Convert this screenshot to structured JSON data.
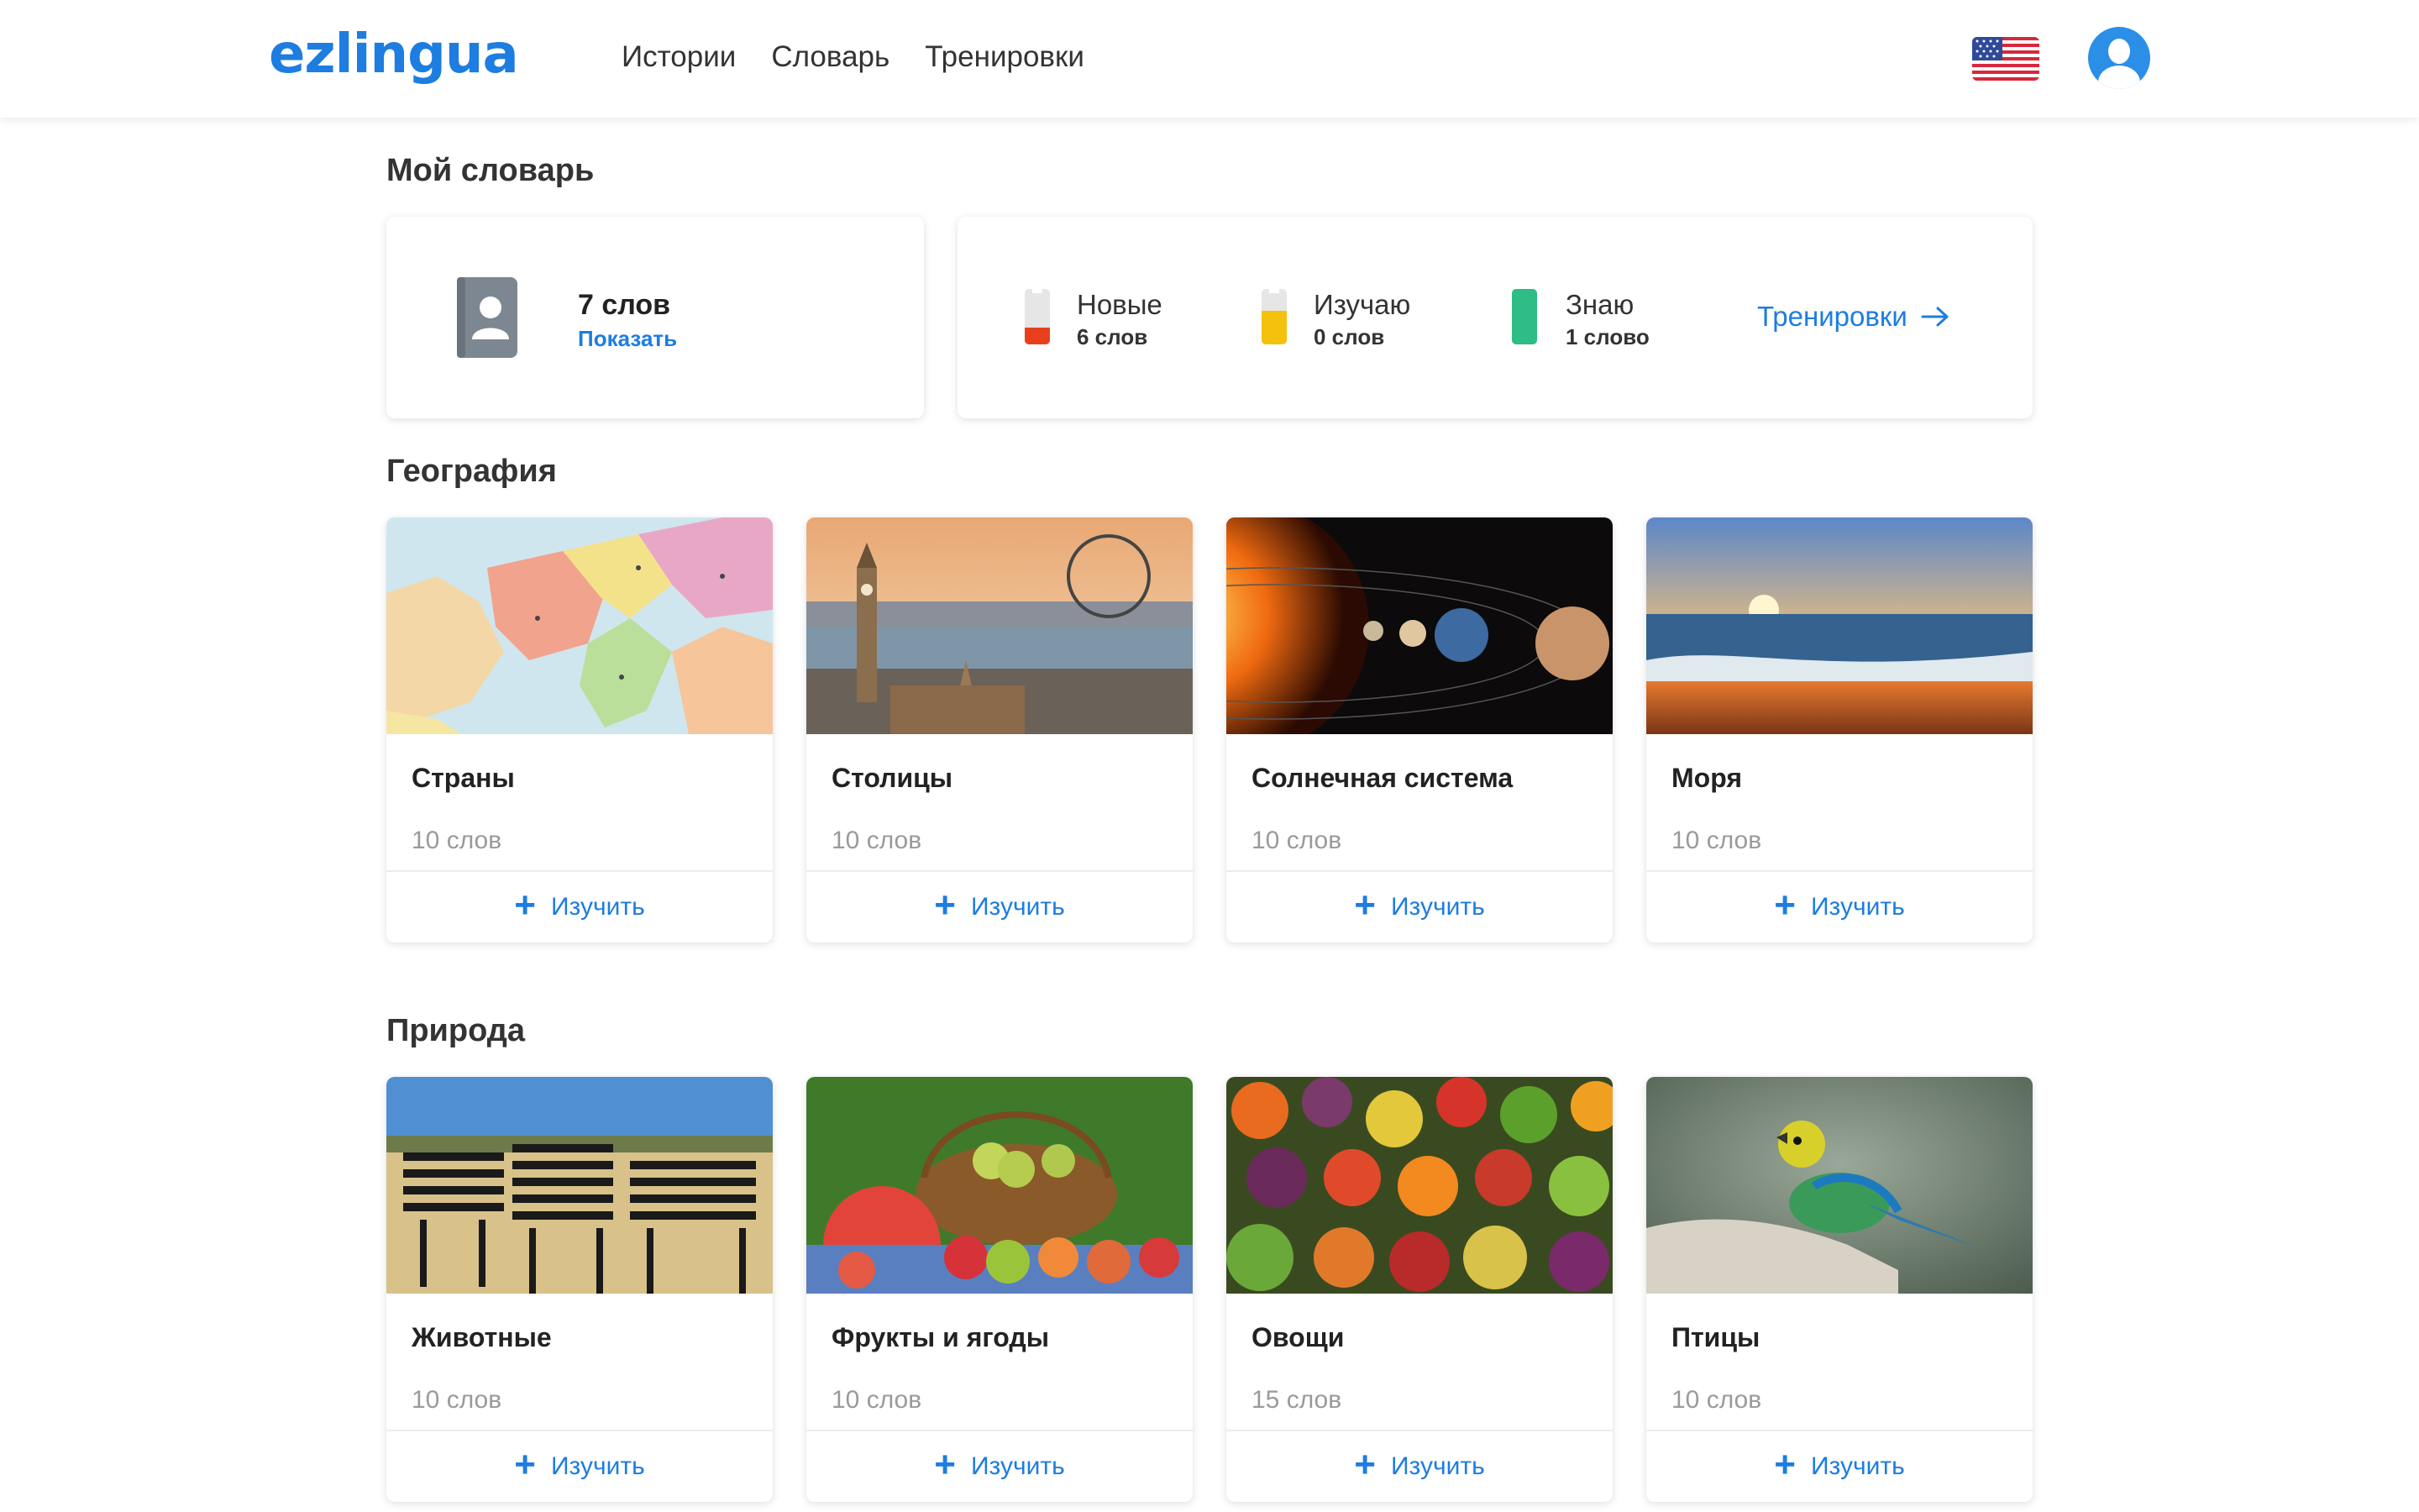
{
  "header": {
    "logo": "ezlingua",
    "nav": [
      "Истории",
      "Словарь",
      "Тренировки"
    ],
    "language_icon": "us-flag-icon",
    "user_icon": "user-avatar-icon"
  },
  "dictionary": {
    "title": "Мой словарь",
    "word_count": "7 слов",
    "show_label": "Показать",
    "stats": [
      {
        "label": "Новые",
        "count": "6 слов",
        "color": "#e8401c",
        "fill": 0.3
      },
      {
        "label": "Изучаю",
        "count": "0 слов",
        "color": "#f4c20d",
        "fill": 0.6
      },
      {
        "label": "Знаю",
        "count": "1 слово",
        "color": "#2ebd85",
        "fill": 1.0
      }
    ],
    "training_link": "Тренировки"
  },
  "sections": [
    {
      "title": "География",
      "topics": [
        {
          "title": "Страны",
          "count": "10 слов",
          "button": "Изучить"
        },
        {
          "title": "Столицы",
          "count": "10 слов",
          "button": "Изучить"
        },
        {
          "title": "Солнечная система",
          "count": "10 слов",
          "button": "Изучить"
        },
        {
          "title": "Моря",
          "count": "10 слов",
          "button": "Изучить"
        }
      ]
    },
    {
      "title": "Природа",
      "topics": [
        {
          "title": "Животные",
          "count": "10 слов",
          "button": "Изучить"
        },
        {
          "title": "Фрукты и ягоды",
          "count": "10 слов",
          "button": "Изучить"
        },
        {
          "title": "Овощи",
          "count": "15 слов",
          "button": "Изучить"
        },
        {
          "title": "Птицы",
          "count": "10 слов",
          "button": "Изучить"
        }
      ]
    }
  ],
  "colors": {
    "accent": "#1d7de0"
  }
}
